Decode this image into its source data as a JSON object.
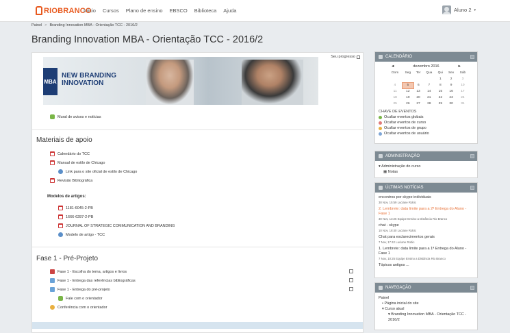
{
  "brand": {
    "name": "RIOBRANCO",
    "color": "#e85a1f"
  },
  "nav": [
    "Início",
    "Cursos",
    "Plano de ensino",
    "EBSCO",
    "Biblioteca",
    "Ajuda"
  ],
  "user": {
    "name": "Aluno 2",
    "caret": "▾"
  },
  "breadcrumb": [
    "Painel",
    "Branding Innovation MBA - Orientação TCC - 2016/2"
  ],
  "page_title": "Branding Innovation MBA - Orientação TCC - 2016/2",
  "progress_label": "Seu progresso",
  "banner": {
    "badge": "MBA",
    "line1": "NEW BRANDING",
    "line2": "INNOVATION"
  },
  "top_items": [
    {
      "label": "Mural de avisos e notícias",
      "icon": "forum-icon"
    }
  ],
  "sections": {
    "materiais": {
      "title": "Materiais de apoio",
      "items": [
        "Calendário do TCC",
        "Manual de estilo de Chicago",
        "Link para o site oficial de estilo de Chicago",
        "Revisão Bibliográfica"
      ],
      "subheading": "Modelos de artigos:",
      "artigos": [
        "1181-6045-2-PB",
        "1666-6287-2-PB",
        "JOURNAL OF STRATEGIC COMMUNICATION AND BRANDING",
        "Modelo de artigo - TCC"
      ]
    },
    "fase1": {
      "title": "Fase 1 - Pré-Projeto",
      "items": [
        "Fase 1 - Escolha do tema, artigos e livros",
        "Fase 1 - Entrega das referências bibliográficas",
        "Fase 1 - Entrega do pré-projeto",
        "Fale com o orientador",
        "Conferência com o orientador"
      ]
    }
  },
  "calendar": {
    "block_title": "CALENDÁRIO",
    "prev": "◄",
    "month": "dezembro 2016",
    "next": "►",
    "weekdays": [
      "Dom",
      "Seg",
      "Ter",
      "Qua",
      "Qui",
      "Sex",
      "Sáb"
    ],
    "rows": [
      [
        "",
        "",
        "",
        "",
        "1",
        "2",
        "3"
      ],
      [
        "4",
        "5",
        "6",
        "7",
        "8",
        "9",
        "10"
      ],
      [
        "11",
        "12",
        "13",
        "14",
        "15",
        "16",
        "17"
      ],
      [
        "18",
        "19",
        "20",
        "21",
        "22",
        "23",
        "24"
      ],
      [
        "25",
        "26",
        "27",
        "28",
        "29",
        "30",
        "31"
      ]
    ],
    "today": "5",
    "legend_title": "CHAVE DE EVENTOS",
    "legend": [
      {
        "label": "Ocultar eventos globais",
        "color": "#7ab648"
      },
      {
        "label": "Ocultar eventos de curso",
        "color": "#e07a7a"
      },
      {
        "label": "Ocultar eventos de grupo",
        "color": "#e9b040"
      },
      {
        "label": "Ocultar eventos de usuário",
        "color": "#7ea6d6"
      }
    ]
  },
  "admin": {
    "block_title": "ADMINISTRAÇÃO",
    "items": [
      "Administração do curso",
      "Notas"
    ]
  },
  "news": {
    "block_title": "ÚLTIMAS NOTÍCIAS",
    "items": [
      {
        "title": "encontros por skype individuais",
        "date": "30 Nov, 15:59",
        "author": "Luciane Robic",
        "highlight": false
      },
      {
        "title": "2. Lembrete: data limite para a 2ª Entrega do Aluno - Fase 1",
        "date": "30 Nov, 13:26",
        "author": "Equipe Ensino a Distância Rio Branco",
        "highlight": true
      },
      {
        "title": "chat - skype",
        "date": "10 Nov, 18:40",
        "author": "Luciane Robic",
        "highlight": false
      },
      {
        "title": "Chat para esclarecimentos gerais",
        "date": "7 Nov, 17:42",
        "author": "Luciane Robic",
        "highlight": false
      },
      {
        "title": "1. Lembrete: data limite para a 1ª Entrega do Aluno - Fase 1",
        "date": "7 Nov, 10:25",
        "author": "Equipe Ensino a Distância Rio Branco",
        "highlight": false
      }
    ],
    "more": "Tópicos antigos ..."
  },
  "navigation": {
    "block_title": "NAVEGAÇÃO",
    "items": [
      "Painel",
      "Página inicial do site",
      "Curso atual",
      "Branding Innovation MBA - Orientação TCC - 2016/2"
    ]
  }
}
